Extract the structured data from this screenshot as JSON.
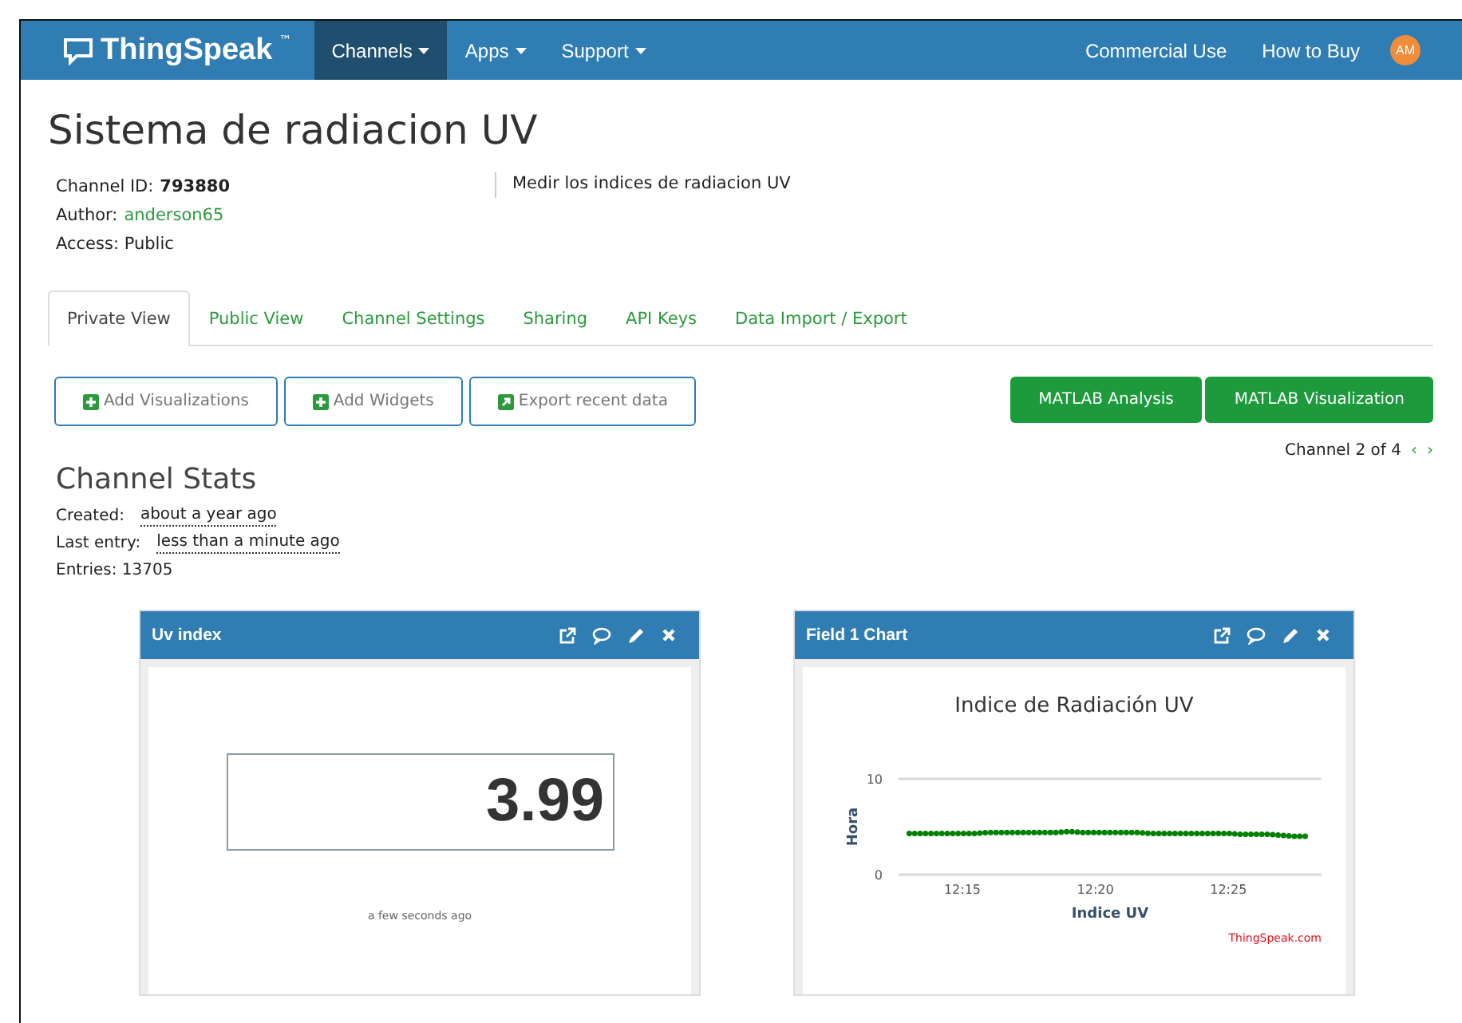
{
  "navbar": {
    "brand": "ThingSpeak",
    "trademark": "™",
    "menus": [
      {
        "label": "Channels",
        "selected": true
      },
      {
        "label": "Apps",
        "selected": false
      },
      {
        "label": "Support",
        "selected": false
      }
    ],
    "links": [
      "Commercial Use",
      "How to Buy"
    ],
    "avatar": "AM"
  },
  "channel": {
    "title": "Sistema de radiacion UV",
    "id_label": "Channel ID:",
    "id": "793880",
    "author_label": "Author:",
    "author": "anderson65",
    "access": "Access: Public",
    "description": "Medir los indices de radiacion UV"
  },
  "tabs": [
    {
      "label": "Private View",
      "selected": true
    },
    {
      "label": "Public View",
      "selected": false
    },
    {
      "label": "Channel Settings",
      "selected": false
    },
    {
      "label": "Sharing",
      "selected": false
    },
    {
      "label": "API Keys",
      "selected": false
    },
    {
      "label": "Data Import / Export",
      "selected": false
    }
  ],
  "actions": [
    {
      "label": "Add Visualizations",
      "kind": "plus"
    },
    {
      "label": "Add Widgets",
      "kind": "plus"
    },
    {
      "label": "Export recent data",
      "kind": "export"
    }
  ],
  "matlab_buttons": [
    "MATLAB Analysis",
    "MATLAB Visualization"
  ],
  "pager": {
    "label": "Channel 2 of 4",
    "prev": "‹",
    "next": "›"
  },
  "stats": {
    "heading": "Channel Stats",
    "created_label": "Created:",
    "created": "about a year ago",
    "last_label": "Last entry:",
    "last": "less than a minute ago",
    "entries": "Entries: 13705"
  },
  "widgets": [
    {
      "kind": "numeric",
      "title": "Uv index",
      "value": "3.99",
      "updated": "a few seconds ago"
    },
    {
      "kind": "chart",
      "title": "Field 1 Chart",
      "credit": "ThingSpeak.com",
      "chart_data": {
        "type": "line",
        "title": "Indice de Radiación UV",
        "xlabel": "Indice UV",
        "ylabel": "Hora",
        "ylim": [
          0,
          10
        ],
        "yticks": [
          0,
          10
        ],
        "categories": [
          null,
          null,
          null,
          null,
          "12:15",
          null,
          null,
          null,
          null,
          null,
          null,
          null,
          null,
          null,
          "12:20",
          null,
          null,
          null,
          null,
          null,
          null,
          null,
          null,
          null,
          "12:25",
          null,
          null,
          null,
          null,
          null,
          null
        ],
        "series": [
          {
            "color": "#008000",
            "line_style": "dotted",
            "values": [
              4.3,
              4.3,
              4.3,
              4.3,
              4.3,
              4.3,
              4.4,
              4.4,
              4.4,
              4.4,
              4.4,
              4.4,
              4.5,
              4.4,
              4.4,
              4.4,
              4.4,
              4.4,
              4.3,
              4.3,
              4.3,
              4.3,
              4.3,
              4.3,
              4.3,
              4.2,
              4.2,
              4.2,
              4.1,
              4.0,
              4.0
            ]
          }
        ]
      }
    }
  ]
}
